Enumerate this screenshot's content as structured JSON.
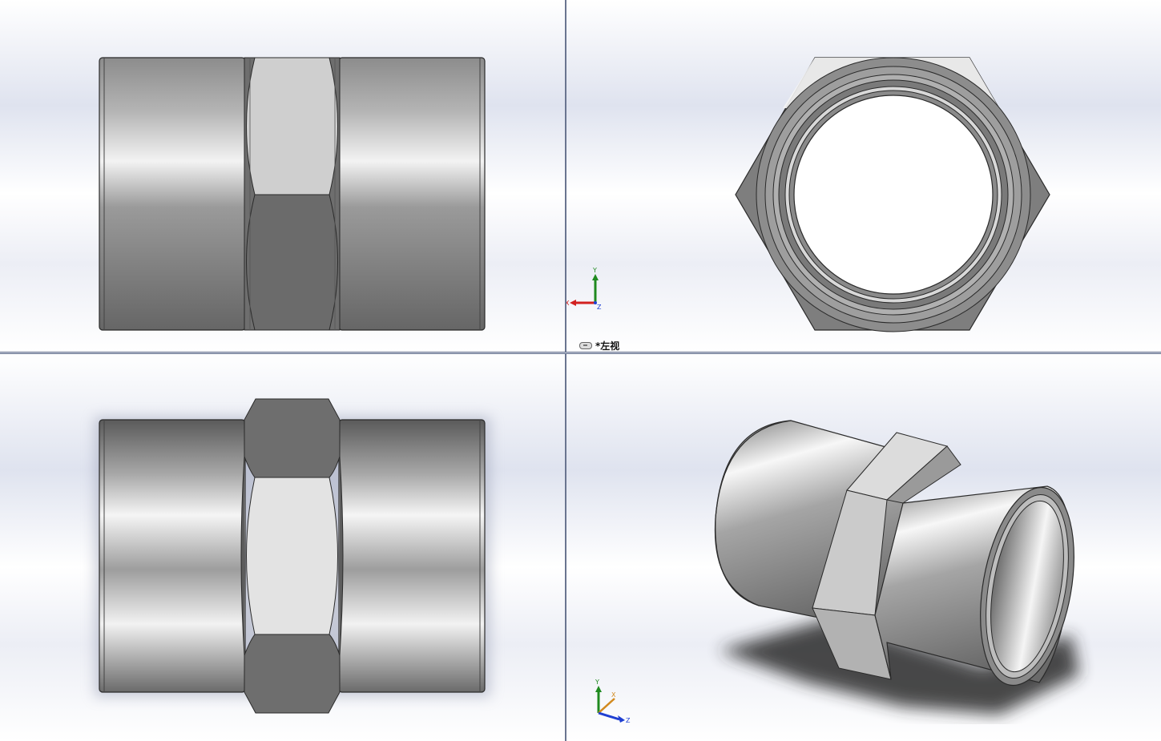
{
  "viewports": {
    "front": {},
    "left": {
      "view_label": "*左视"
    },
    "top": {},
    "isometric": {}
  },
  "triad_left": {
    "x": "X",
    "y": "Y",
    "z": "Z"
  },
  "triad_iso": {
    "x": "X",
    "y": "Y",
    "z": "Z"
  },
  "colors": {
    "model_dark": "#5c5c5c",
    "model_mid": "#8a8a8a",
    "model_light": "#e6e6e6",
    "edge": "#2a2a2a",
    "background_top": "#ffffff",
    "background_band": "#dfe3ef",
    "axis_x": "#d22020",
    "axis_y": "#1f8a1f",
    "axis_z": "#1f3fd2"
  }
}
